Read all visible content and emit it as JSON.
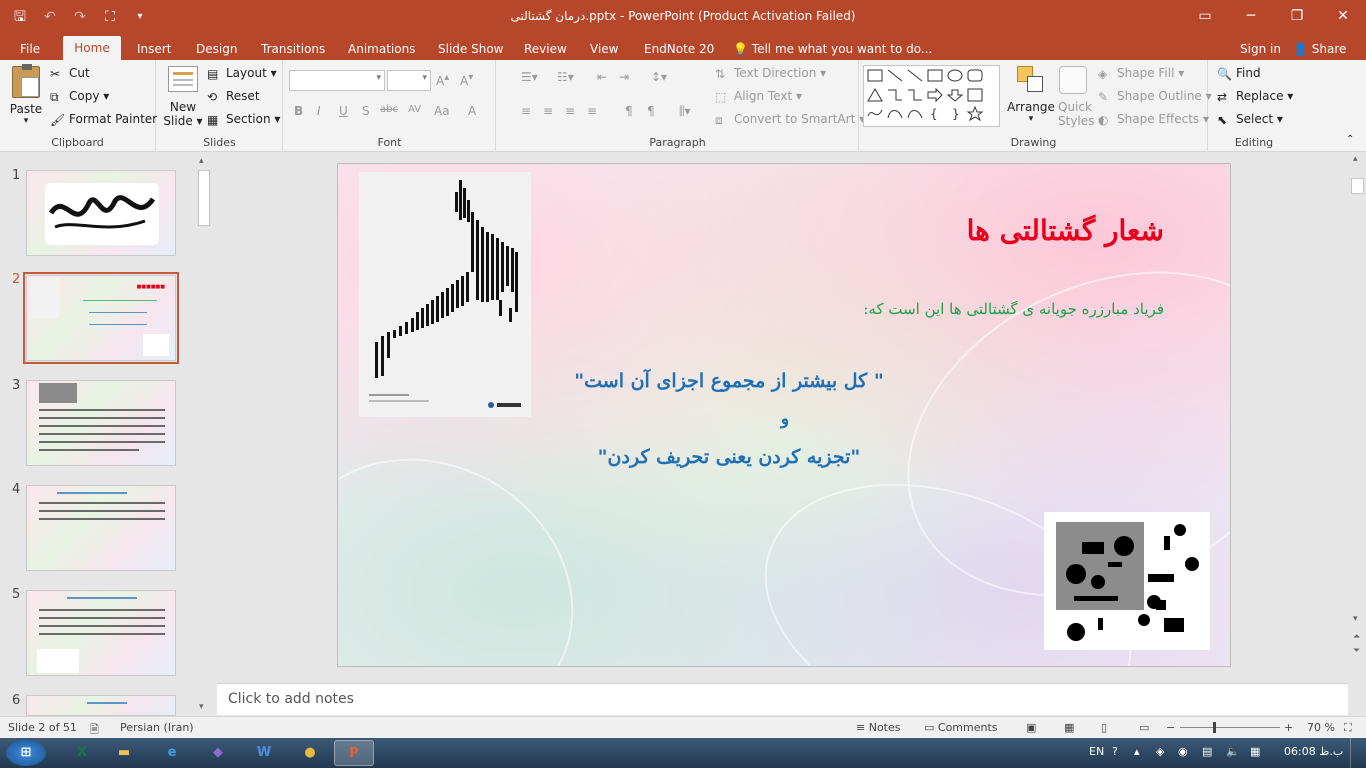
{
  "titlebar": {
    "title": "درمان گشتالتی.pptx - PowerPoint (Product Activation Failed)"
  },
  "tabs": {
    "items": [
      "File",
      "Home",
      "Insert",
      "Design",
      "Transitions",
      "Animations",
      "Slide Show",
      "Review",
      "View",
      "EndNote 20"
    ],
    "active": "Home",
    "tell_me": "Tell me what you want to do...",
    "sign_in": "Sign in",
    "share": "Share"
  },
  "ribbon": {
    "clipboard": {
      "label": "Clipboard",
      "paste": "Paste",
      "cut": "Cut",
      "copy": "Copy",
      "format_painter": "Format Painter"
    },
    "slides": {
      "label": "Slides",
      "new_slide_1": "New",
      "new_slide_2": "Slide",
      "layout": "Layout",
      "reset": "Reset",
      "section": "Section"
    },
    "font": {
      "label": "Font",
      "bold": "B",
      "italic": "I",
      "underline": "U",
      "shadow": "S",
      "strike": "abc",
      "spacing": "AV",
      "case": "Aa"
    },
    "paragraph": {
      "label": "Paragraph",
      "text_direction": "Text Direction",
      "align_text": "Align Text",
      "convert": "Convert to SmartArt"
    },
    "drawing": {
      "label": "Drawing",
      "arrange": "Arrange",
      "quick_styles_1": "Quick",
      "quick_styles_2": "Styles",
      "shape_fill": "Shape Fill",
      "shape_outline": "Shape Outline",
      "shape_effects": "Shape Effects"
    },
    "editing": {
      "label": "Editing",
      "find": "Find",
      "replace": "Replace",
      "select": "Select"
    }
  },
  "thumbnails": {
    "numbers": [
      "1",
      "2",
      "3",
      "4",
      "5",
      "6"
    ],
    "selected_index": 2
  },
  "slide": {
    "title": "شعار گشتالتی ها",
    "subtitle": "فریاد مبارزره جویانه ی گشتالتی ها این است که:",
    "quote1": "\" کل بیشتر از مجموع اجزای آن است\"",
    "conj": "و",
    "quote2": "\"تجزیه کردن یعنی تحریف کردن\""
  },
  "notes": {
    "placeholder": "Click to add notes"
  },
  "status": {
    "slide_info": "Slide 2 of 51",
    "language": "Persian (Iran)",
    "notes": "Notes",
    "comments": "Comments",
    "zoom": "70 %"
  },
  "taskbar": {
    "lang": "EN",
    "time": "06:08 ب.ظ"
  },
  "colors": {
    "accent": "#b7472a",
    "slide_title": "#e8001c",
    "slide_subtitle": "#17a34a",
    "slide_quote": "#1f6fb5"
  }
}
